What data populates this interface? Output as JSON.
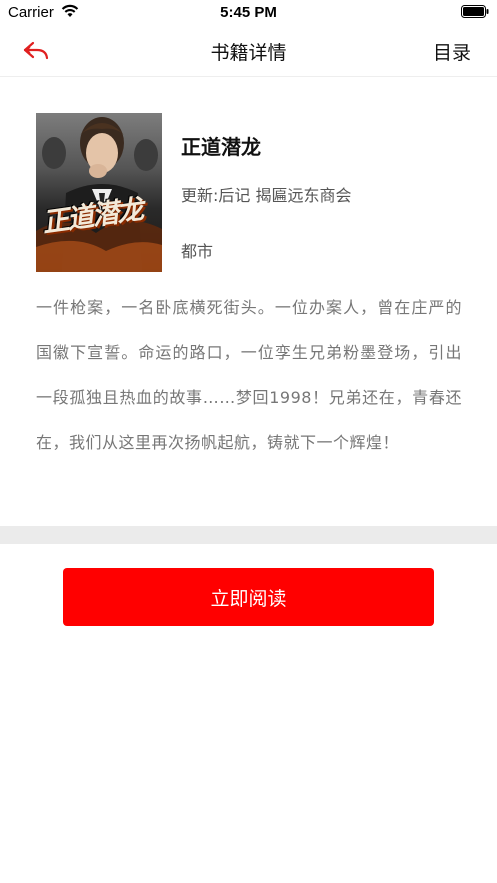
{
  "status_bar": {
    "carrier": "Carrier",
    "time": "5:45 PM"
  },
  "nav": {
    "title": "书籍详情",
    "catalog_label": "目录",
    "back_icon": "back-arrow-icon"
  },
  "book": {
    "cover_text": "正道潜龙",
    "title": "正道潜龙",
    "update": "更新:后记 揭匾远东商会",
    "genre": "都市",
    "description": "一件枪案，一名卧底横死街头。一位办案人，曾在庄严的国徽下宣誓。命运的路口，一位孪生兄弟粉墨登场，引出一段孤独且热血的故事……梦回1998！兄弟还在，青春还在，我们从这里再次扬帆起航，铸就下一个辉煌！"
  },
  "actions": {
    "read_now": "立即阅读"
  },
  "colors": {
    "accent": "#ff0000",
    "divider": "#ebebeb"
  }
}
